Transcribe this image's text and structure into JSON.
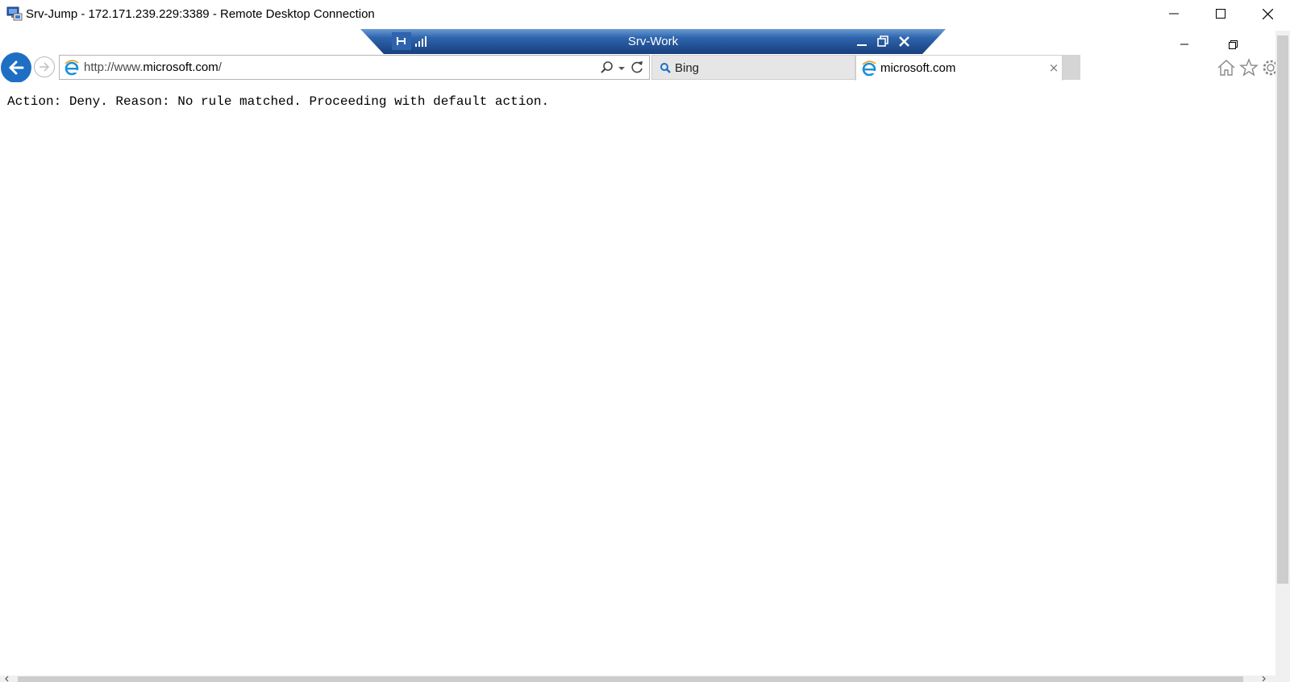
{
  "rdp_window": {
    "title": "Srv-Jump - 172.171.239.229:3389 - Remote Desktop Connection",
    "icon": "remote-desktop-icon",
    "controls": [
      "minimize-icon",
      "maximize-icon",
      "close-icon"
    ]
  },
  "connection_bar": {
    "title": "Srv-Work",
    "left_icons": [
      "pin-icon",
      "signal-strength-icon"
    ],
    "right_icons": [
      "minimize-icon",
      "restore-icon",
      "close-icon"
    ],
    "colors": {
      "bar": "#1f4f8f",
      "bar_edge": "#6a9bd4"
    }
  },
  "browser": {
    "address": {
      "prefix": "http://www.",
      "host": "microsoft.com",
      "suffix": "/",
      "full": "http://www.microsoft.com/"
    },
    "tabs": [
      {
        "label": "Bing",
        "icon": "search-icon",
        "active": false
      },
      {
        "label": "microsoft.com",
        "icon": "ie-logo-icon",
        "active": true,
        "close": "×"
      }
    ],
    "command_icons": [
      "home-icon",
      "favorites-star-icon",
      "gear-icon"
    ],
    "colors": {
      "back_button": "#1e6fc4",
      "ie_logo": "#1b8fdc"
    }
  },
  "page": {
    "message": "Action: Deny. Reason: No rule matched. Proceeding with default action."
  }
}
